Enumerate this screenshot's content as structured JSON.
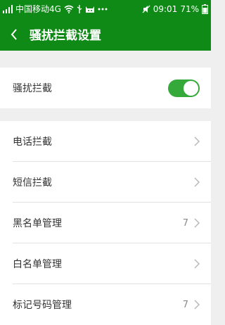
{
  "statusbar": {
    "carrier": "中国移动4G",
    "time": "09:01",
    "battery": "71%",
    "icons": [
      "wifi-icon",
      "usb-icon",
      "cat-icon",
      "more-dots-icon",
      "mute-icon",
      "signal-icon",
      "battery-icon"
    ]
  },
  "appbar": {
    "title": "骚扰拦截设置"
  },
  "toggle_row": {
    "label": "骚扰拦截",
    "enabled": true
  },
  "menu": [
    {
      "label": "电话拦截",
      "count": ""
    },
    {
      "label": "短信拦截",
      "count": ""
    },
    {
      "label": "黑名单管理",
      "count": "7"
    },
    {
      "label": "白名单管理",
      "count": ""
    },
    {
      "label": "标记号码管理",
      "count": "7"
    }
  ],
  "colors": {
    "primary": "#0f8a16",
    "switch_on": "#35a93a",
    "background": "#efefef"
  }
}
